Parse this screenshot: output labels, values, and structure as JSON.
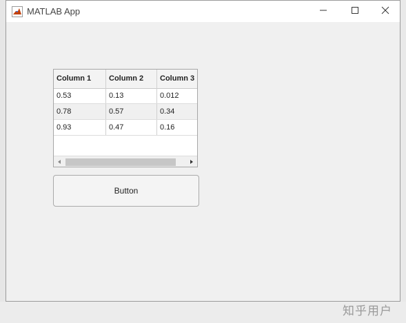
{
  "window": {
    "title": "MATLAB App",
    "controls": {
      "minimize": "minimize-icon",
      "maximize": "maximize-icon",
      "close": "close-icon"
    }
  },
  "table": {
    "columns": [
      "Column 1",
      "Column 2",
      "Column 3"
    ],
    "rows": [
      [
        "0.53",
        "0.13",
        "0.012"
      ],
      [
        "0.78",
        "0.57",
        "0.34"
      ],
      [
        "0.93",
        "0.47",
        "0.16"
      ]
    ]
  },
  "button": {
    "label": "Button"
  },
  "watermark": "知乎用户"
}
